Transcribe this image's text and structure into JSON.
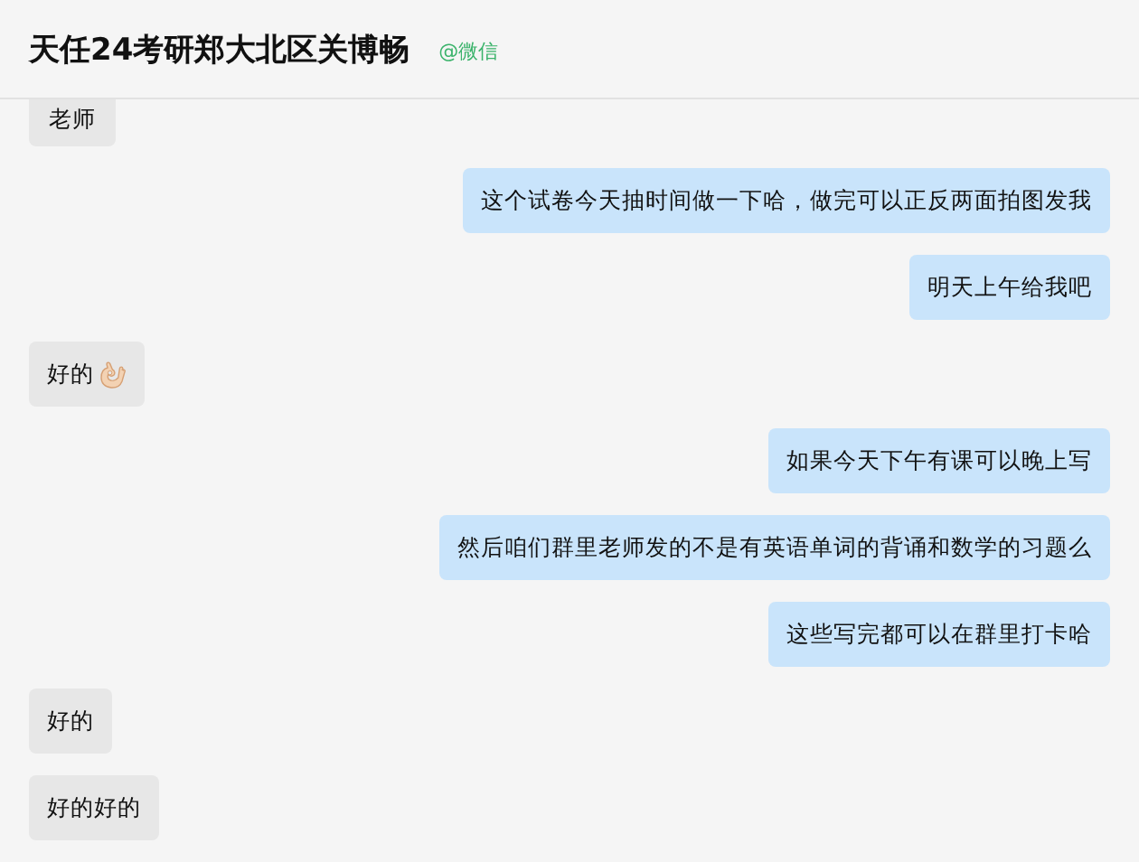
{
  "header": {
    "title": "天任24考研郑大北区关博畅",
    "source": "@微信"
  },
  "messages": [
    {
      "kind": "incoming",
      "text": "老师",
      "cut": true
    },
    {
      "kind": "outgoing",
      "text": "这个试卷今天抽时间做一下哈，做完可以正反两面拍图发我"
    },
    {
      "kind": "outgoing",
      "text": "明天上午给我吧"
    },
    {
      "kind": "incoming",
      "text": "好的",
      "ok_hand_emoji": true
    },
    {
      "kind": "outgoing",
      "text": "如果今天下午有课可以晚上写"
    },
    {
      "kind": "outgoing",
      "text": "然后咱们群里老师发的不是有英语单词的背诵和数学的习题么"
    },
    {
      "kind": "outgoing",
      "text": "这些写完都可以在群里打卡哈"
    },
    {
      "kind": "incoming",
      "text": "好的"
    },
    {
      "kind": "incoming",
      "text": "好的好的"
    }
  ]
}
